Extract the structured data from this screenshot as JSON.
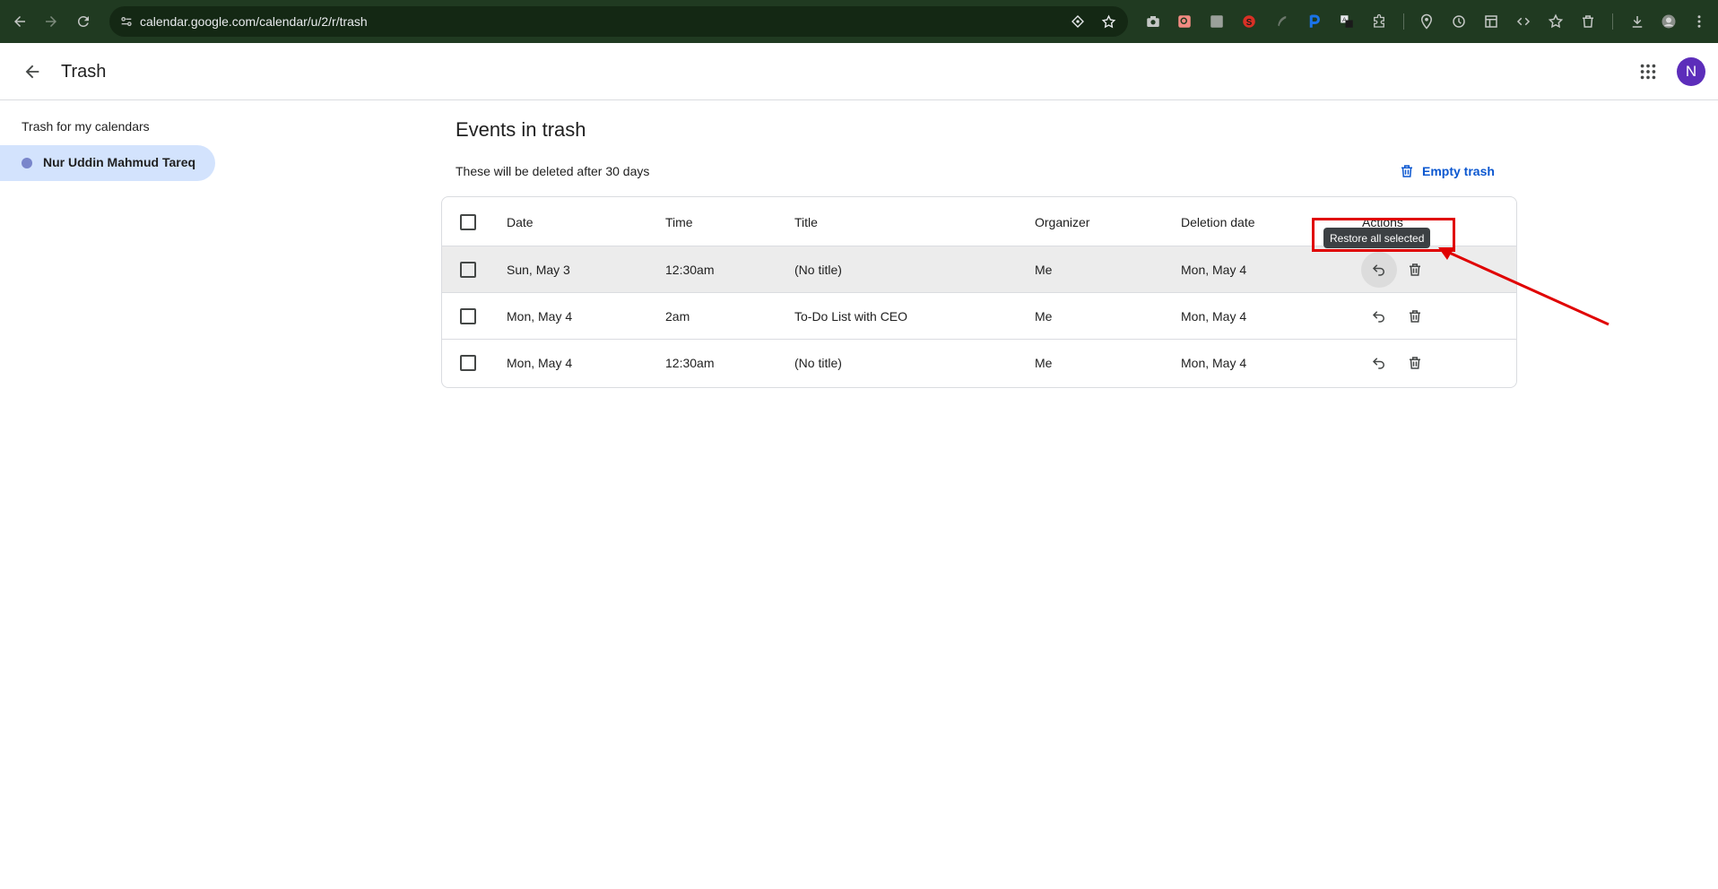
{
  "browser": {
    "url": "calendar.google.com/calendar/u/2/r/trash"
  },
  "header": {
    "title": "Trash",
    "avatar_initial": "N",
    "avatar_color": "#5c2dba"
  },
  "sidebar": {
    "heading": "Trash for my calendars",
    "items": [
      {
        "label": "Nur Uddin Mahmud Tareq",
        "color": "#7986cb"
      }
    ]
  },
  "main": {
    "title": "Events in trash",
    "subtitle": "These will be deleted after 30 days",
    "empty_trash_label": "Empty trash",
    "columns": [
      "Date",
      "Time",
      "Title",
      "Organizer",
      "Deletion date",
      "Actions"
    ],
    "rows": [
      {
        "date": "Sun, May 3",
        "time": "12:30am",
        "title": "(No title)",
        "organizer": "Me",
        "deletion_date": "Mon, May 4"
      },
      {
        "date": "Mon, May 4",
        "time": "2am",
        "title": "To-Do List with CEO",
        "organizer": "Me",
        "deletion_date": "Mon, May 4"
      },
      {
        "date": "Mon, May 4",
        "time": "12:30am",
        "title": "(No title)",
        "organizer": "Me",
        "deletion_date": "Mon, May 4"
      }
    ],
    "tooltip": "Restore all selected"
  },
  "colors": {
    "accent": "#0b57d0",
    "annotation": "#e00000",
    "sidebar_selected": "#d3e3fd"
  }
}
